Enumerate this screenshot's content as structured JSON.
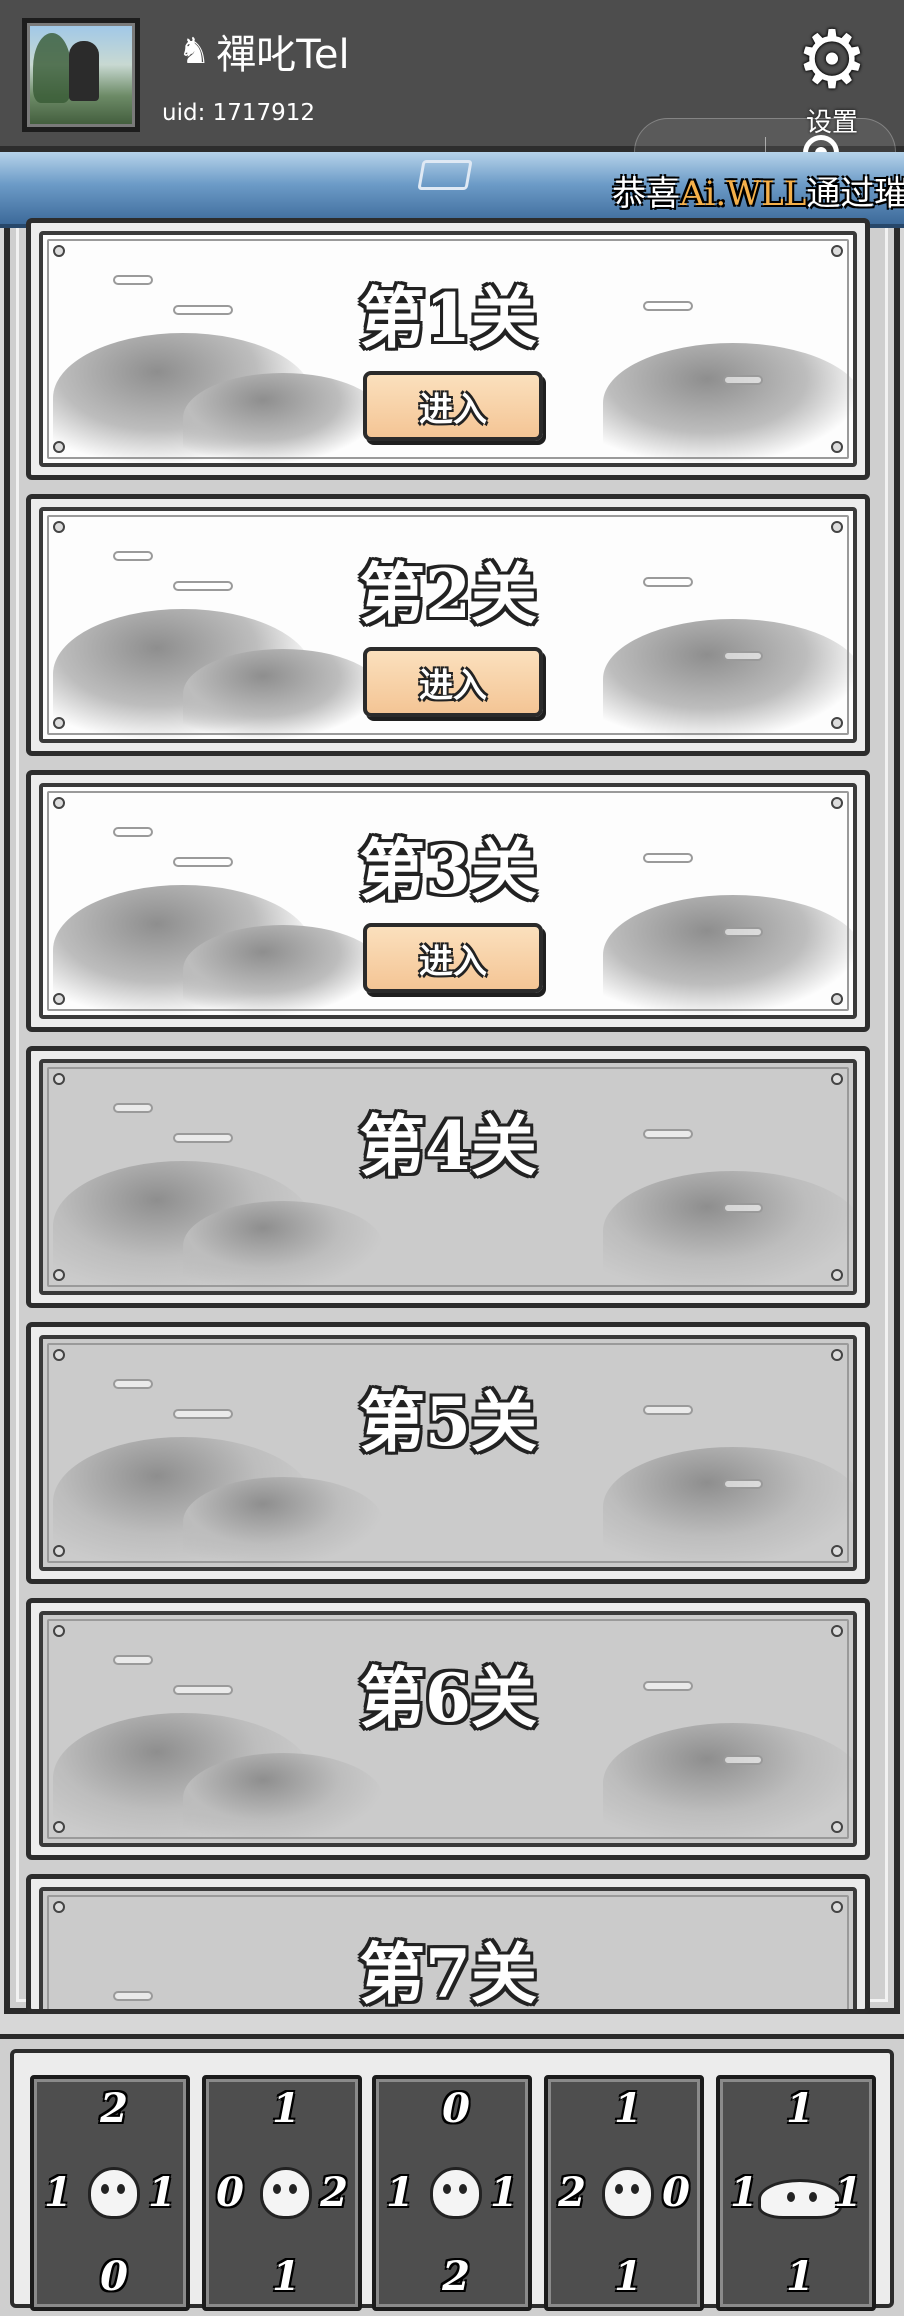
{
  "header": {
    "username_icon": "knight-chess-icon",
    "username": "禪叱Tel",
    "uid": "uid: 1717912",
    "settings_label": "设置",
    "settings_icon": "gear-icon"
  },
  "banner": {
    "prefix": "恭喜",
    "highlight_name": "Ai.WLL",
    "suffix": "通过璀"
  },
  "levels": [
    {
      "title": "第1关",
      "unlocked": true,
      "button": "进入"
    },
    {
      "title": "第2关",
      "unlocked": true,
      "button": "进入"
    },
    {
      "title": "第3关",
      "unlocked": true,
      "button": "进入"
    },
    {
      "title": "第4关",
      "unlocked": false
    },
    {
      "title": "第5关",
      "unlocked": false
    },
    {
      "title": "第6关",
      "unlocked": false
    },
    {
      "title": "第7关",
      "unlocked": false
    }
  ],
  "cards": [
    {
      "top": "2",
      "left": "1",
      "right": "1",
      "bottom": "0",
      "creature": "frog-creature-icon"
    },
    {
      "top": "1",
      "left": "0",
      "right": "2",
      "bottom": "1",
      "creature": "frog-creature-icon"
    },
    {
      "top": "0",
      "left": "1",
      "right": "1",
      "bottom": "2",
      "creature": "frog-creature-icon"
    },
    {
      "top": "1",
      "left": "2",
      "right": "0",
      "bottom": "1",
      "creature": "frog-creature-icon"
    },
    {
      "top": "1",
      "left": "1",
      "right": "1",
      "bottom": "1",
      "creature": "slime-creature-icon"
    }
  ],
  "colors": {
    "header_bg": "#4d4d4d",
    "button_fill": "#f4c595",
    "highlight": "#f5b04a",
    "locked_panel": "#cbcbcb",
    "card_bg": "#4e4e4e"
  }
}
